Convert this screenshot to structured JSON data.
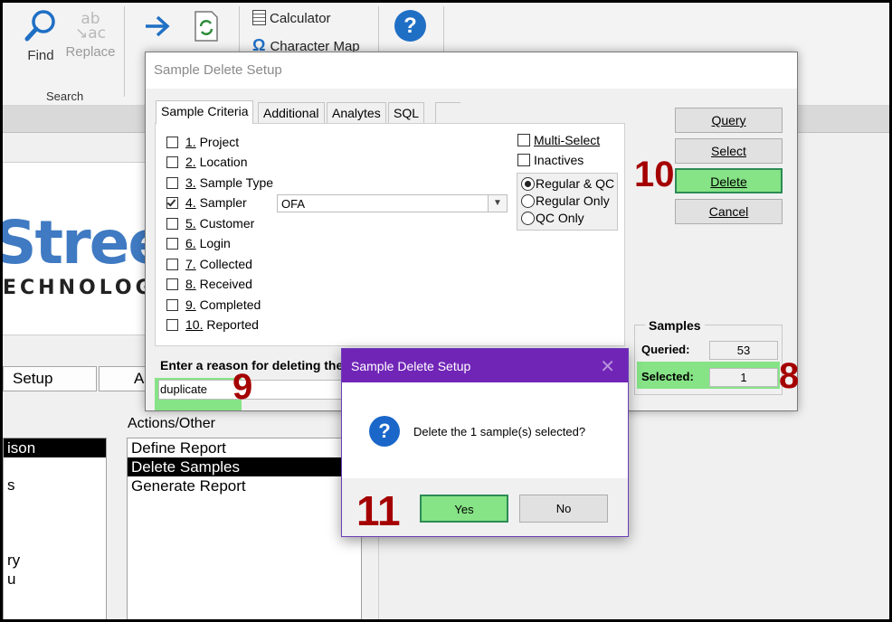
{
  "ribbon": {
    "find_label": "Find",
    "replace_label": "Replace",
    "search_group": "Search",
    "calculator_label": "Calculator",
    "charmap_label": "Character Map",
    "colors": {
      "icon_blue": "#1f6fc5",
      "icon_green": "#2e8b3a"
    }
  },
  "background": {
    "setup_button": "Setup",
    "second_button": "A",
    "actions_heading": "Actions/Other",
    "actions": [
      "Define Report",
      "Delete Samples",
      "Generate Report"
    ],
    "selected_action": "Delete Samples",
    "left_list_selected": "ison",
    "left_list_fragments": [
      "s",
      "ry",
      "u"
    ],
    "logo_main": "Stree",
    "logo_sub": "ECHNOLOG"
  },
  "dialog": {
    "title": "Sample Delete Setup",
    "tabs": [
      "Sample Criteria",
      "Additional",
      "Analytes",
      "SQL"
    ],
    "active_tab": "Sample Criteria",
    "criteria": [
      {
        "key": "1.",
        "label": "Project",
        "checked": false
      },
      {
        "key": "2.",
        "label": "Location",
        "checked": false
      },
      {
        "key": "3.",
        "label": "Sample Type",
        "checked": false
      },
      {
        "key": "4.",
        "label": "Sampler",
        "checked": true
      },
      {
        "key": "5.",
        "label": "Customer",
        "checked": false
      },
      {
        "key": "6.",
        "label": "Login",
        "checked": false
      },
      {
        "key": "7.",
        "label": "Collected",
        "checked": false
      },
      {
        "key": "8.",
        "label": "Received",
        "checked": false
      },
      {
        "key": "9.",
        "label": "Completed",
        "checked": false
      },
      {
        "key": "10.",
        "label": "Reported",
        "checked": false
      }
    ],
    "sampler_value": "OFA",
    "multi_select_label": "Multi-Select",
    "inactives_label": "Inactives",
    "radios": [
      "Regular & QC",
      "Regular Only",
      "QC Only"
    ],
    "radio_selected": "Regular & QC",
    "buttons": {
      "query": "Query",
      "select": "Select",
      "delete": "Delete",
      "cancel": "Cancel"
    },
    "samples": {
      "legend": "Samples",
      "queried_label": "Queried:",
      "queried_value": "53",
      "selected_label": "Selected:",
      "selected_value": "1"
    },
    "reason_label": "Enter a reason for deleting the s",
    "reason_value": "duplicate"
  },
  "confirm": {
    "title": "Sample Delete Setup",
    "message": "Delete the 1 sample(s) selected?",
    "yes": "Yes",
    "no": "No"
  },
  "annotations": {
    "reason": "9",
    "delete": "10",
    "selected": "8",
    "yes": "11"
  },
  "colors": {
    "highlight": "#86e386",
    "annotation": "#a50000",
    "confirm_titlebar": "#7125b7",
    "question_icon": "#1a67c9"
  }
}
